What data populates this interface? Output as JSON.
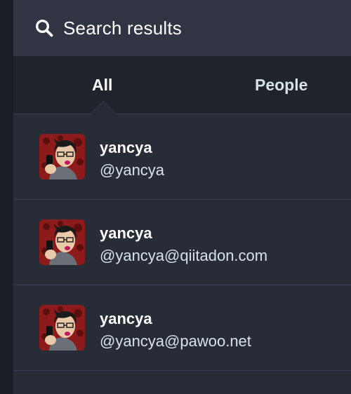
{
  "header": {
    "title": "Search results",
    "icon": "search-icon"
  },
  "tabs": [
    {
      "label": "All",
      "active": true
    },
    {
      "label": "People",
      "active": false
    }
  ],
  "accounts": [
    {
      "display_name": "yancya",
      "acct": "@yancya",
      "avatar": "avatar-icon"
    },
    {
      "display_name": "yancya",
      "acct": "@yancya@qiitadon.com",
      "avatar": "avatar-icon"
    },
    {
      "display_name": "yancya",
      "acct": "@yancya@pawoo.net",
      "avatar": "avatar-icon"
    }
  ],
  "colors": {
    "background": "#282c37",
    "header": "#313543",
    "tabs": "#1f232b",
    "divider": "#393f4f",
    "text": "#ffffff",
    "muted_text": "#d9e1e8"
  }
}
